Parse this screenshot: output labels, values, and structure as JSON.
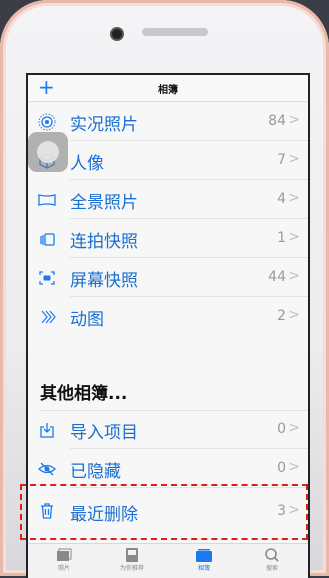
{
  "nav": {
    "add_label": "+",
    "title": "相簿"
  },
  "albums": [
    {
      "label": "实况照片",
      "count": "84",
      "icon": "live-photo-icon"
    },
    {
      "label": "人像",
      "count": "7",
      "icon": "cube-icon"
    },
    {
      "label": "全景照片",
      "count": "4",
      "icon": "panorama-icon"
    },
    {
      "label": "连拍快照",
      "count": "1",
      "icon": "burst-icon"
    },
    {
      "label": "屏幕快照",
      "count": "44",
      "icon": "screenshot-icon"
    },
    {
      "label": "动图",
      "count": "2",
      "icon": "animated-icon"
    }
  ],
  "other": {
    "title": "其他相簿...",
    "items": [
      {
        "label": "导入项目",
        "count": "0",
        "icon": "import-icon"
      },
      {
        "label": "已隐藏",
        "count": "0",
        "icon": "hidden-eye-icon"
      },
      {
        "label": "最近删除",
        "count": "3",
        "icon": "trash-icon"
      }
    ]
  },
  "chevron": ">",
  "tabs": [
    {
      "label": "照片",
      "icon": "photos-tab-icon"
    },
    {
      "label": "为你推荐",
      "icon": "for-you-tab-icon"
    },
    {
      "label": "相簿",
      "icon": "albums-tab-icon"
    },
    {
      "label": "搜索",
      "icon": "search-tab-icon"
    }
  ],
  "colors": {
    "accent": "#1a7af0",
    "highlight": "#e01d1d"
  }
}
